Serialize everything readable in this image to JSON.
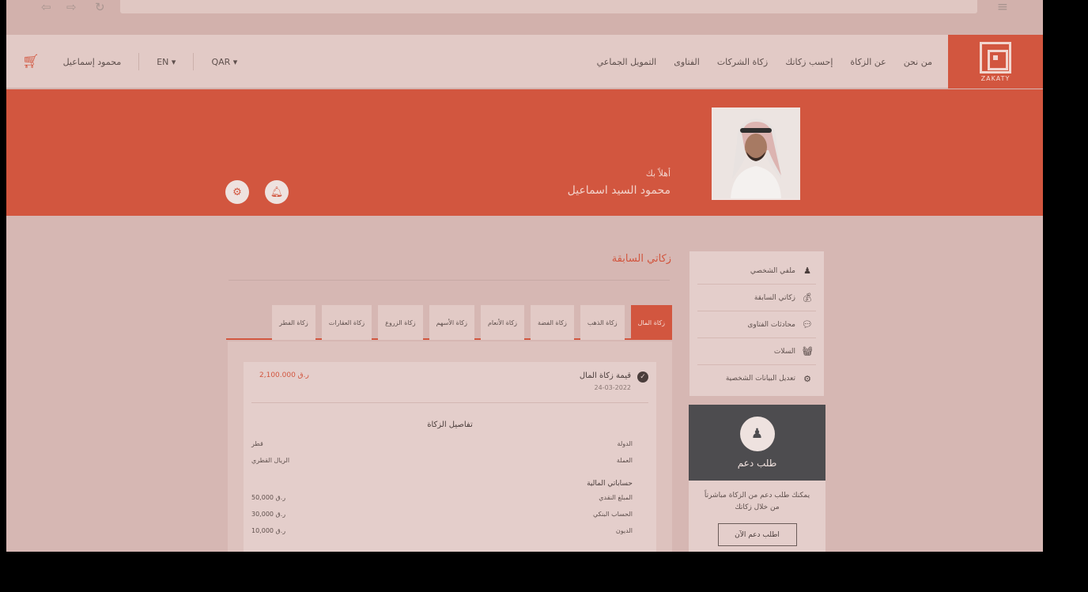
{
  "header": {
    "logo_text": "ZAKATY",
    "nav": [
      "من نحن",
      "عن الزكاة",
      "إحسب زكاتك",
      "زكاة الشركات",
      "الفتاوى",
      "التمويل الجماعي"
    ],
    "currency": "QAR ▾",
    "language": "EN ▾",
    "user_name": "محمود إسماعيل"
  },
  "hero": {
    "greeting": "أهلاً بك",
    "name": "محمود السيد اسماعيل"
  },
  "sidebar": {
    "items": [
      {
        "label": "ملفي الشخصي",
        "icon": "user-icon"
      },
      {
        "label": "زكاتي السابقة",
        "icon": "money-bag-icon"
      },
      {
        "label": "محادثات الفتاوى",
        "icon": "chat-icon"
      },
      {
        "label": "السلات",
        "icon": "basket-icon"
      },
      {
        "label": "تعديل البيانات الشخصية",
        "icon": "gear-icon"
      }
    ]
  },
  "support": {
    "title": "طلب دعم",
    "text": "يمكنك طلب دعم من الزكاة مباشرتاً من خلال زكاتك",
    "button": "اطلب دعم الآن"
  },
  "main": {
    "title": "زكاتي السابقة",
    "tabs": [
      "زكاة المال",
      "زكاة الذهب",
      "زكاة الفضة",
      "زكاة الأنعام",
      "زكاة الأسهم",
      "زكاة الزروع",
      "زكاة العقارات",
      "زكاة الفطر"
    ],
    "card": {
      "title": "قيمة زكاة المال",
      "date": "24-03-2022",
      "amount": "2,100.000 ر.ق",
      "details_title": "تفاصيل الزكاة",
      "rows": [
        {
          "key": "الدولة",
          "value": "قطر"
        },
        {
          "key": "العملة",
          "value": "الريال القطري"
        }
      ],
      "calc_title": "حساباتي المالية",
      "calc_rows": [
        {
          "key": "المبلغ النقدي",
          "value": "50,000 ر.ق"
        },
        {
          "key": "الحساب البنكي",
          "value": "30,000 ر.ق"
        },
        {
          "key": "الديون",
          "value": "10,000 ر.ق"
        }
      ]
    }
  },
  "colors": {
    "brand": "#d2563f",
    "dark_panel": "#4d4c4f"
  }
}
